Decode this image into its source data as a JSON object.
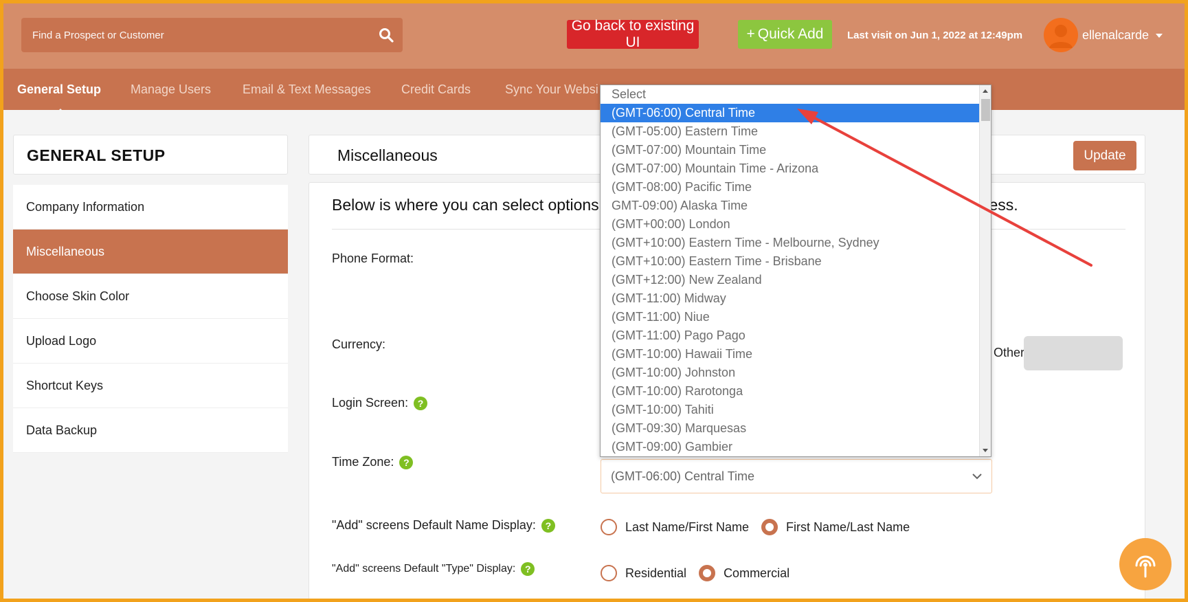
{
  "header": {
    "search_placeholder": "Find a Prospect or Customer",
    "go_back_label": "Go back to existing UI",
    "quick_add_label": "Quick Add",
    "quick_add_plus": "+",
    "last_visit": "Last visit on  Jun 1, 2022  at 12:49pm",
    "username": "ellenalcarde"
  },
  "nav": {
    "items": [
      {
        "label": "General Setup"
      },
      {
        "label": "Manage Users"
      },
      {
        "label": "Email & Text Messages"
      },
      {
        "label": "Credit Cards"
      },
      {
        "label": "Sync Your Websi"
      }
    ]
  },
  "sidebar": {
    "title": "GENERAL SETUP",
    "items": [
      {
        "label": "Company Information"
      },
      {
        "label": "Miscellaneous"
      },
      {
        "label": "Choose Skin Color"
      },
      {
        "label": "Upload Logo"
      },
      {
        "label": "Shortcut Keys"
      },
      {
        "label": "Data Backup"
      }
    ],
    "active_index": 1
  },
  "main": {
    "title": "Miscellaneous",
    "update_label": "Update",
    "intro_left": "Below is where you can select options",
    "intro_right": "ness.",
    "labels": {
      "phone_format": "Phone Format:",
      "currency": "Currency:",
      "other": "Other",
      "login_screen": "Login Screen:",
      "time_zone": "Time Zone:",
      "name_display": "\"Add\" screens Default Name Display:",
      "type_display": "\"Add\" screens Default \"Type\" Display:"
    },
    "help_glyph": "?",
    "time_zone_value": "(GMT-06:00) Central Time",
    "name_display_options": [
      "Last Name/First Name",
      "First Name/Last Name"
    ],
    "name_display_selected": 1,
    "type_display_options": [
      "Residential",
      "Commercial"
    ],
    "type_display_selected": 1
  },
  "dropdown": {
    "selected_index": 1,
    "options": [
      "Select",
      "(GMT-06:00) Central Time",
      "(GMT-05:00) Eastern Time",
      "(GMT-07:00) Mountain Time",
      "(GMT-07:00) Mountain Time - Arizona",
      "(GMT-08:00) Pacific Time",
      "GMT-09:00) Alaska Time",
      "(GMT+00:00) London",
      "(GMT+10:00) Eastern Time - Melbourne, Sydney",
      "(GMT+10:00) Eastern Time - Brisbane",
      "(GMT+12:00) New Zealand",
      "(GMT-11:00) Midway",
      "(GMT-11:00) Niue",
      "(GMT-11:00) Pago Pago",
      "(GMT-10:00) Hawaii Time",
      "(GMT-10:00) Johnston",
      "(GMT-10:00) Rarotonga",
      "(GMT-10:00) Tahiti",
      "(GMT-09:30) Marquesas",
      "(GMT-09:00) Gambier"
    ]
  },
  "colors": {
    "frame": "#f2a21c",
    "header": "#d58d6a",
    "nav": "#c8734f",
    "accent": "#c8734f",
    "go_back": "#d8262a",
    "quick_add": "#8cc63f",
    "help": "#7fbf22",
    "selection": "#2f7fe6",
    "annotation_arrow": "#e8413c"
  }
}
